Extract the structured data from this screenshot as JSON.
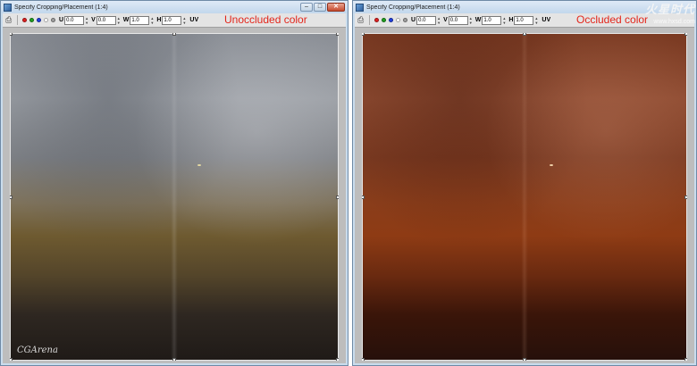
{
  "windows": [
    {
      "title": "Specify Cropping/Placement (1:4)",
      "annotation": "Unoccluded color",
      "fields": {
        "u": "0.0",
        "v": "0.0",
        "w": "1.0",
        "h": "1.0"
      }
    },
    {
      "title": "Specify Cropping/Placement (1:4)",
      "annotation": "Occluded color",
      "fields": {
        "u": "0.0",
        "v": "0.0",
        "w": "1.0",
        "h": "1.0"
      }
    }
  ],
  "toolbar": {
    "u_label": "U",
    "v_label": "V",
    "w_label": "W",
    "h_label": "H",
    "uv_label": "UV",
    "channel_colors": [
      "#e02020",
      "#20a020",
      "#2040e0",
      "#ffffff",
      "#a0a0a0"
    ],
    "icons": [
      "print-icon"
    ]
  },
  "window_controls": {
    "minimize": "–",
    "maximize": "□",
    "close": "✕"
  },
  "watermarks": {
    "cgarena": "CGArena",
    "logo_main": "火星时代",
    "logo_sub": "www.hxsd.com"
  }
}
